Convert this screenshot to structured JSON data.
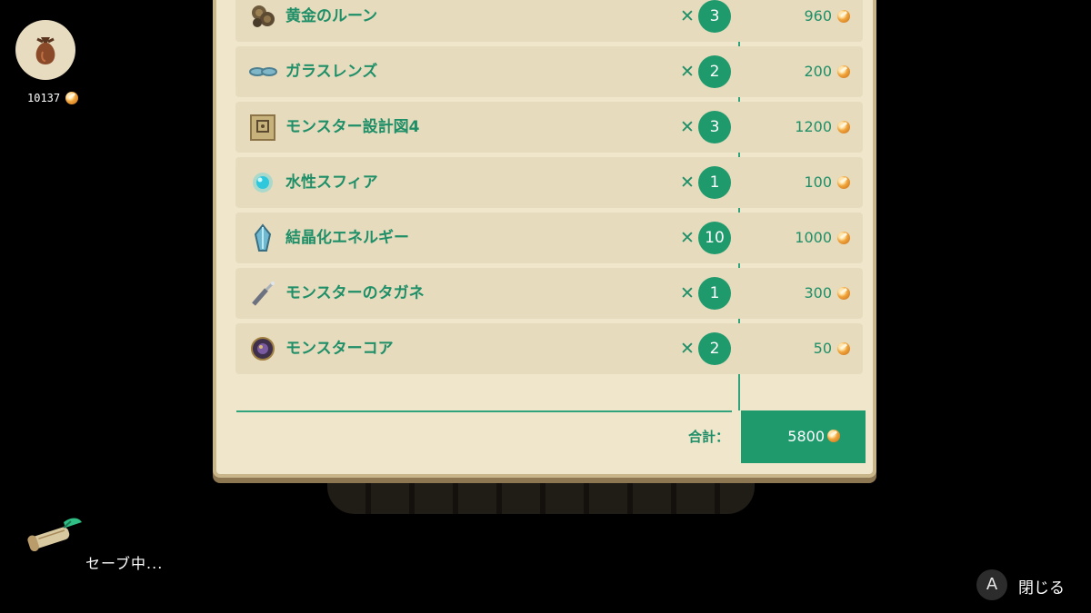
{
  "wallet": {
    "gold": "10137"
  },
  "items": [
    {
      "name": "黄金のルーン",
      "times": "✕",
      "qty": "3",
      "price": "960",
      "icon": "golden-rune-icon"
    },
    {
      "name": "ガラスレンズ",
      "times": "✕",
      "qty": "2",
      "price": "200",
      "icon": "glass-lens-icon"
    },
    {
      "name": "モンスター設計図4",
      "times": "✕",
      "qty": "3",
      "price": "1200",
      "icon": "monster-blueprint-icon"
    },
    {
      "name": "水性スフィア",
      "times": "✕",
      "qty": "1",
      "price": "100",
      "icon": "water-sphere-icon"
    },
    {
      "name": "結晶化エネルギー",
      "times": "✕",
      "qty": "10",
      "price": "1000",
      "icon": "crystal-energy-icon"
    },
    {
      "name": "モンスターのタガネ",
      "times": "✕",
      "qty": "1",
      "price": "300",
      "icon": "monster-chisel-icon"
    },
    {
      "name": "モンスターコア",
      "times": "✕",
      "qty": "2",
      "price": "50",
      "icon": "monster-core-icon"
    }
  ],
  "total": {
    "label": "合計：",
    "value": "5800"
  },
  "status": {
    "saving": "セーブ中..."
  },
  "controls": {
    "a_button": "A",
    "close_label": "閉じる"
  },
  "colors": {
    "accent": "#1f9a6d",
    "panel": "#efe6cc",
    "row": "#e6dbbd"
  }
}
